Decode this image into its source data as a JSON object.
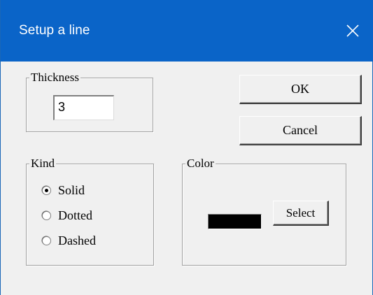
{
  "window": {
    "title": "Setup a line",
    "close_glyph": "close-icon",
    "titlebar_color": "#0a64c8"
  },
  "thickness": {
    "label": "Thickness",
    "value": "3"
  },
  "buttons": {
    "ok_label": "OK",
    "cancel_label": "Cancel"
  },
  "kind": {
    "label": "Kind",
    "options": [
      {
        "label": "Solid",
        "selected": true
      },
      {
        "label": "Dotted",
        "selected": false
      },
      {
        "label": "Dashed",
        "selected": false
      }
    ]
  },
  "color": {
    "label": "Color",
    "current_color": "#000000",
    "select_label": "Select"
  }
}
